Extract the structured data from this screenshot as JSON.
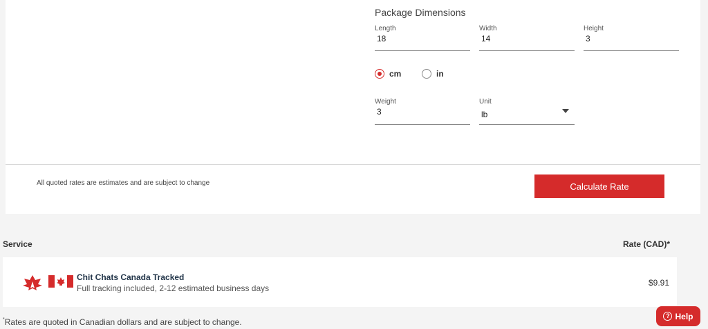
{
  "dimensions": {
    "title": "Package Dimensions",
    "length": {
      "label": "Length",
      "value": "18"
    },
    "width": {
      "label": "Width",
      "value": "14"
    },
    "height": {
      "label": "Height",
      "value": "3"
    },
    "units": [
      {
        "label": "cm",
        "selected": true
      },
      {
        "label": "in",
        "selected": false
      }
    ],
    "weight": {
      "label": "Weight",
      "value": "3"
    },
    "unit": {
      "label": "Unit",
      "value": "lb"
    }
  },
  "footer": {
    "disclaimer": "All quoted rates are estimates and are subject to change",
    "calculate_label": "Calculate Rate"
  },
  "results": {
    "service_header": "Service",
    "rate_header": "Rate (CAD)*",
    "rows": [
      {
        "name": "Chit Chats Canada Tracked",
        "description": "Full tracking included, 2-12 estimated business days",
        "price": "$9.91",
        "icons": [
          "maple-leaf-logo",
          "canada-flag"
        ]
      }
    ],
    "footnote_mark": "*",
    "footnote": "Rates are quoted in Canadian dollars and are subject to change."
  },
  "help": {
    "label": "Help",
    "icon": "question-circle-icon"
  },
  "colors": {
    "accent": "#d52b2b",
    "background": "#f4f4f4",
    "card": "#ffffff"
  }
}
